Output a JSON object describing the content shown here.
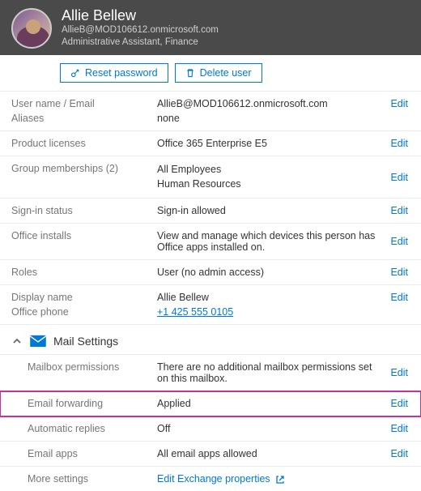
{
  "header": {
    "name": "Allie Bellew",
    "email": "AllieB@MOD106612.onmicrosoft.com",
    "title": "Administrative Assistant, Finance"
  },
  "actions": {
    "reset_password": "Reset password",
    "delete_user": "Delete user"
  },
  "labels": {
    "username_email": "User name / Email",
    "aliases": "Aliases",
    "product_licenses": "Product licenses",
    "group_memberships": "Group memberships (2)",
    "signin_status": "Sign-in status",
    "office_installs": "Office installs",
    "roles": "Roles",
    "display_name": "Display name",
    "office_phone": "Office phone",
    "mail_settings": "Mail Settings",
    "mailbox_permissions": "Mailbox permissions",
    "email_forwarding": "Email forwarding",
    "automatic_replies": "Automatic replies",
    "email_apps": "Email apps",
    "more_settings": "More settings",
    "edit": "Edit"
  },
  "values": {
    "username_email": "AllieB@MOD106612.onmicrosoft.com",
    "aliases": "none",
    "product_licenses": "Office 365 Enterprise E5",
    "group1": "All Employees",
    "group2": "Human Resources",
    "signin_status": "Sign-in allowed",
    "office_installs": "View and manage which devices this person has Office apps installed on.",
    "roles": "User (no admin access)",
    "display_name": "Allie Bellew",
    "office_phone": "+1 425 555 0105",
    "mailbox_permissions": "There are no additional mailbox permissions set on this mailbox.",
    "email_forwarding": "Applied",
    "automatic_replies": "Off",
    "email_apps": "All email apps allowed",
    "more_settings_link": "Edit Exchange properties"
  }
}
